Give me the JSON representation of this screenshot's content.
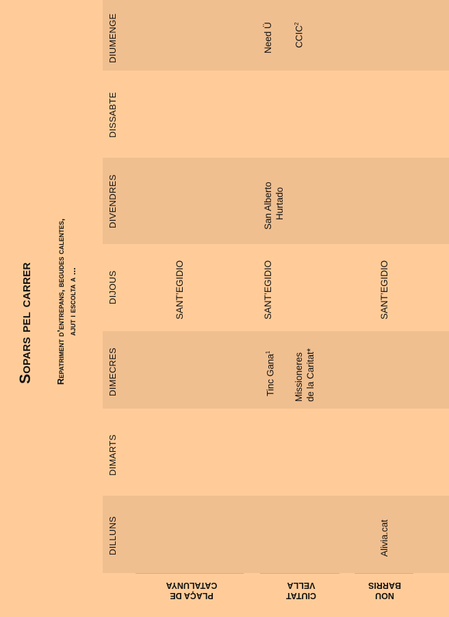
{
  "title": "Sopars pel carrer",
  "subtitle_line1": "Repatriment d’entrepans, begudes calentes,",
  "subtitle_line2": "ajut i escolta a ...",
  "days": [
    "DILLUNS",
    "DIMARTS",
    "DIMECRES",
    "DIJOUS",
    "DIVENDRES",
    "DISSABTE",
    "DIUMENGE"
  ],
  "areas": {
    "placa_line1": "PLAÇA  DE",
    "placa_line2": "CATALUNYA",
    "ciutat_line1": "CIUTAT",
    "ciutat_line2": "VELLA",
    "nou_line1": "NOU",
    "nou_line2": "BARRIS"
  },
  "entries": {
    "alivia": "Alivia.cat",
    "tinc_gana": "Tinc Gana",
    "tinc_gana_sup": "1",
    "missioneres_line1": "Missioneres",
    "missioneres_line2": "de la Caritat*",
    "santegidio_placa": "SANT’EGIDIO",
    "santegidio_ciutat": "SANT’EGIDIO",
    "santegidio_nou": "SANT’EGIDIO",
    "san_alberto_line1": "San Alberto",
    "san_alberto_line2": "Hurtado",
    "need_u": "Need Ü",
    "ccic": "CCIC",
    "ccic_sup": "2"
  },
  "colors": {
    "background": "#ffcc99",
    "band": "#f0bf90",
    "rule": "#e8a66b"
  }
}
